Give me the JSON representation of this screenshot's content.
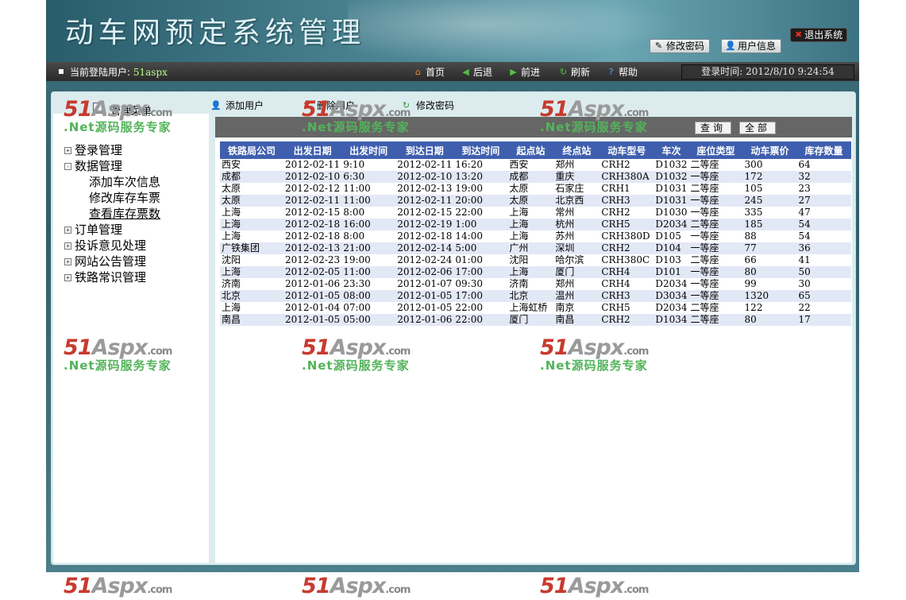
{
  "header": {
    "title": "动车网预定系统管理",
    "change_password": "修改密码",
    "user_info": "用户信息",
    "logout": "退出系统"
  },
  "infobar": {
    "current_user_label": "当前登陆用户:",
    "current_user": "51aspx",
    "nav": {
      "home": "首页",
      "back": "后退",
      "forward": "前进",
      "refresh": "刷新",
      "help": "帮助"
    },
    "login_time": "登录时间: 2012/8/10 9:24:54"
  },
  "sidebar": {
    "title": "管理菜单",
    "tree": [
      {
        "label": "登录管理",
        "expanded": false,
        "children": []
      },
      {
        "label": "数据管理",
        "expanded": true,
        "children": [
          "添加车次信息",
          "修改库存车票",
          "查看库存票数"
        ]
      },
      {
        "label": "订单管理",
        "expanded": false,
        "children": []
      },
      {
        "label": "投诉意见处理",
        "expanded": false,
        "children": []
      },
      {
        "label": "网站公告管理",
        "expanded": false,
        "children": []
      },
      {
        "label": "铁路常识管理",
        "expanded": false,
        "children": []
      }
    ]
  },
  "toolbar": {
    "add_user": "添加用户",
    "delete_user": "删除用户",
    "change_password": "修改密码"
  },
  "search": {
    "query_button": "查询",
    "all_button": "全部"
  },
  "table": {
    "columns": [
      "铁路局公司",
      "出发日期",
      "出发时间",
      "到达日期",
      "到达时间",
      "起点站",
      "终点站",
      "动车型号",
      "车次",
      "座位类型",
      "动车票价",
      "库存数量"
    ],
    "rows": [
      [
        "西安",
        "2012-02-11",
        "9:10",
        "2012-02-11",
        "16:20",
        "西安",
        "郑州",
        "CRH2",
        "D1032",
        "二等座",
        "300",
        "64"
      ],
      [
        "成都",
        "2012-02-10",
        "6:30",
        "2012-02-10",
        "13:20",
        "成都",
        "重庆",
        "CRH380A",
        "D1032",
        "一等座",
        "172",
        "32"
      ],
      [
        "太原",
        "2012-02-12",
        "11:00",
        "2012-02-13",
        "19:00",
        "太原",
        "石家庄",
        "CRH1",
        "D1031",
        "二等座",
        "105",
        "23"
      ],
      [
        "太原",
        "2012-02-11",
        "11:00",
        "2012-02-11",
        "20:00",
        "太原",
        "北京西",
        "CRH3",
        "D1031",
        "一等座",
        "245",
        "27"
      ],
      [
        "上海",
        "2012-02-15",
        "8:00",
        "2012-02-15",
        "22:00",
        "上海",
        "常州",
        "CRH2",
        "D1030",
        "一等座",
        "335",
        "47"
      ],
      [
        "上海",
        "2012-02-18",
        "16:00",
        "2012-02-19",
        "1:00",
        "上海",
        "杭州",
        "CRH5",
        "D2034",
        "二等座",
        "185",
        "54"
      ],
      [
        "上海",
        "2012-02-18",
        "8:00",
        "2012-02-18",
        "14:00",
        "上海",
        "苏州",
        "CRH380D",
        "D105",
        "一等座",
        "88",
        "54"
      ],
      [
        "广铁集团",
        "2012-02-13",
        "21:00",
        "2012-02-14",
        "5:00",
        "广州",
        "深圳",
        "CRH2",
        "D104",
        "一等座",
        "77",
        "36"
      ],
      [
        "沈阳",
        "2012-02-23",
        "19:00",
        "2012-02-24",
        "01:00",
        "沈阳",
        "哈尔滨",
        "CRH380C",
        "D103",
        "二等座",
        "66",
        "41"
      ],
      [
        "上海",
        "2012-02-05",
        "11:00",
        "2012-02-06",
        "17:00",
        "上海",
        "厦门",
        "CRH4",
        "D101",
        "一等座",
        "80",
        "50"
      ],
      [
        "济南",
        "2012-01-06",
        "23:30",
        "2012-01-07",
        "09:30",
        "济南",
        "郑州",
        "CRH4",
        "D2034",
        "一等座",
        "99",
        "30"
      ],
      [
        "北京",
        "2012-01-05",
        "08:00",
        "2012-01-05",
        "17:00",
        "北京",
        "温州",
        "CRH3",
        "D3034",
        "一等座",
        "1320",
        "65"
      ],
      [
        "上海",
        "2012-01-04",
        "07:00",
        "2012-01-05",
        "22:00",
        "上海虹桥",
        "南京",
        "CRH5",
        "D2034",
        "二等座",
        "122",
        "22"
      ],
      [
        "南昌",
        "2012-01-05",
        "05:00",
        "2012-01-06",
        "22:00",
        "厦门",
        "南昌",
        "CRH2",
        "D1034",
        "二等座",
        "80",
        "17"
      ]
    ]
  },
  "watermark": {
    "brand_num": "51",
    "brand_text": "Aspx",
    "brand_suffix": ".com",
    "slogan": ".Net源码服务专家"
  },
  "colors": {
    "table_header": "#3f5fae",
    "row_alt": "#e3e8f6",
    "user_name": "#b8ff8a",
    "logout_x": "#e0301e"
  }
}
